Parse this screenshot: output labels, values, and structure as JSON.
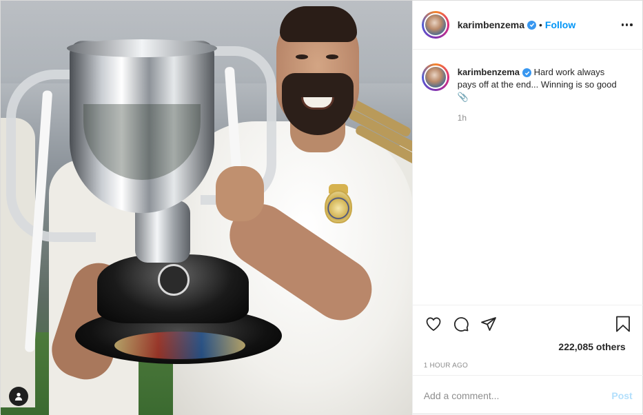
{
  "post": {
    "username": "karimbenzema",
    "separator": "•",
    "follow_label": "Follow",
    "verified_icon": "verified-badge-icon",
    "more_icon": "more-options-icon"
  },
  "caption": {
    "username": "karimbenzema",
    "text": "Hard work always pays off at the end... Winning is so good 📎",
    "relative_time": "1h"
  },
  "actions": {
    "like_icon": "heart-icon",
    "comment_icon": "comment-icon",
    "share_icon": "share-icon",
    "save_icon": "bookmark-icon",
    "likes_text": "222,085 others",
    "post_time": "1 HOUR AGO"
  },
  "comment_box": {
    "placeholder": "Add a comment...",
    "post_label": "Post"
  },
  "colors": {
    "accent": "#0095f6",
    "verified": "#3897f0",
    "post_disabled": "#b2dffc"
  }
}
